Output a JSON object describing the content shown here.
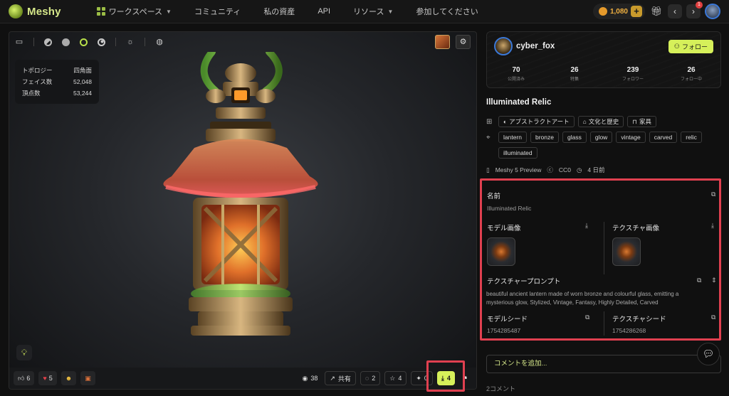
{
  "nav": {
    "logo": "Meshy",
    "items": [
      {
        "label": "ワークスペース"
      },
      {
        "label": "コミュニティ"
      },
      {
        "label": "私の資産"
      },
      {
        "label": "API"
      },
      {
        "label": "リソース"
      },
      {
        "label": "参加してください"
      }
    ],
    "credits": "1,080",
    "notification_count": "1"
  },
  "viewer": {
    "stats": [
      {
        "label": "トポロジー",
        "value": "四角面"
      },
      {
        "label": "フェイス数",
        "value": "52,048"
      },
      {
        "label": "頂点数",
        "value": "53,244"
      }
    ],
    "reactions": [
      {
        "icon": "thumbs-up-icon",
        "count": "6"
      },
      {
        "icon": "heart-icon",
        "count": "5"
      },
      {
        "icon": "laughing-face-icon",
        "count": ""
      },
      {
        "icon": "box-icon",
        "count": ""
      }
    ],
    "views": "38",
    "share_label": "共有",
    "comments": "2",
    "stars": "4",
    "remixes": "0",
    "downloads": "4"
  },
  "profile": {
    "username": "cyber_fox",
    "follow_label": "フォロー",
    "stats": [
      {
        "value": "70",
        "label": "公開済み"
      },
      {
        "value": "26",
        "label": "特集"
      },
      {
        "value": "239",
        "label": "フォロワー"
      },
      {
        "value": "26",
        "label": "フォロー中"
      }
    ]
  },
  "model": {
    "title": "Illuminated Relic",
    "categories": [
      "アブストラクトアート",
      "文化と歴史",
      "家具"
    ],
    "tags": [
      "lantern",
      "bronze",
      "glass",
      "glow",
      "vintage",
      "carved",
      "relic",
      "illuminated"
    ],
    "generator": "Meshy 5 Preview",
    "license": "CC0",
    "age": "4 日前"
  },
  "info": {
    "name_label": "名前",
    "name_value": "Illuminated Relic",
    "model_image_label": "モデル画像",
    "texture_image_label": "テクスチャ画像",
    "texture_prompt_label": "テクスチャープロンプト",
    "texture_prompt": "beautiful ancient lantern made of worn bronze and colourful glass, emitting a mysterious glow, Stylized, Vintage, Fantasy, Highly Detailed, Carved",
    "model_seed_label": "モデルシード",
    "model_seed": "1754285487",
    "texture_seed_label": "テクスチャシード",
    "texture_seed": "1754286268"
  },
  "comment": {
    "placeholder": "コメントを追加...",
    "count_label": "2コメント"
  },
  "colors": {
    "accent": "#d6f05a",
    "highlight": "#e04050"
  }
}
